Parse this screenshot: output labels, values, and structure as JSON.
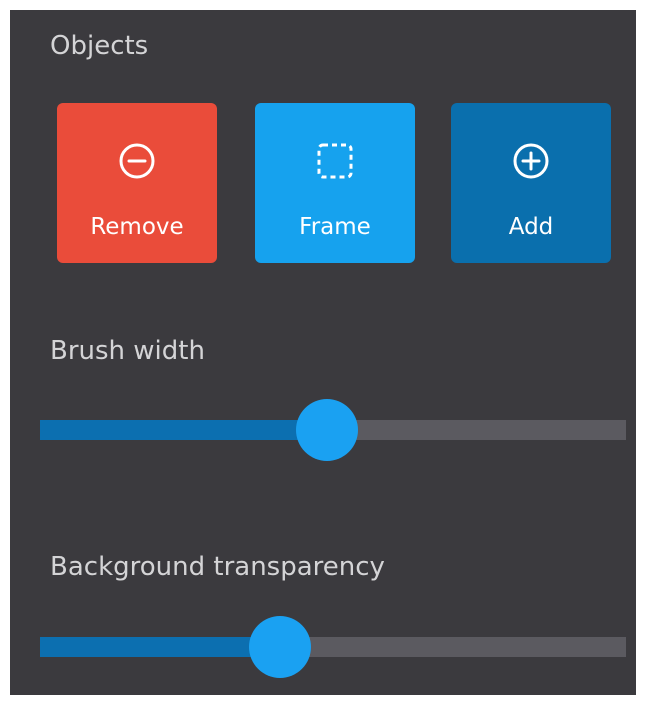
{
  "objects": {
    "title": "Objects",
    "buttons": [
      {
        "label": "Remove",
        "icon": "minus-circle-icon",
        "color": "#ea4c3a"
      },
      {
        "label": "Frame",
        "icon": "dashed-frame-icon",
        "color": "#16a2ee"
      },
      {
        "label": "Add",
        "icon": "plus-circle-icon",
        "color": "#0a6fad"
      }
    ]
  },
  "brush_width": {
    "title": "Brush width",
    "value_fraction": 0.49
  },
  "background_transparency": {
    "title": "Background transparency",
    "value_fraction": 0.41
  },
  "colors": {
    "panel_background": "#3b3a3e",
    "slider_fill": "#0c6fb0",
    "slider_track": "#5b5a60",
    "slider_thumb": "#1aa1f2"
  }
}
